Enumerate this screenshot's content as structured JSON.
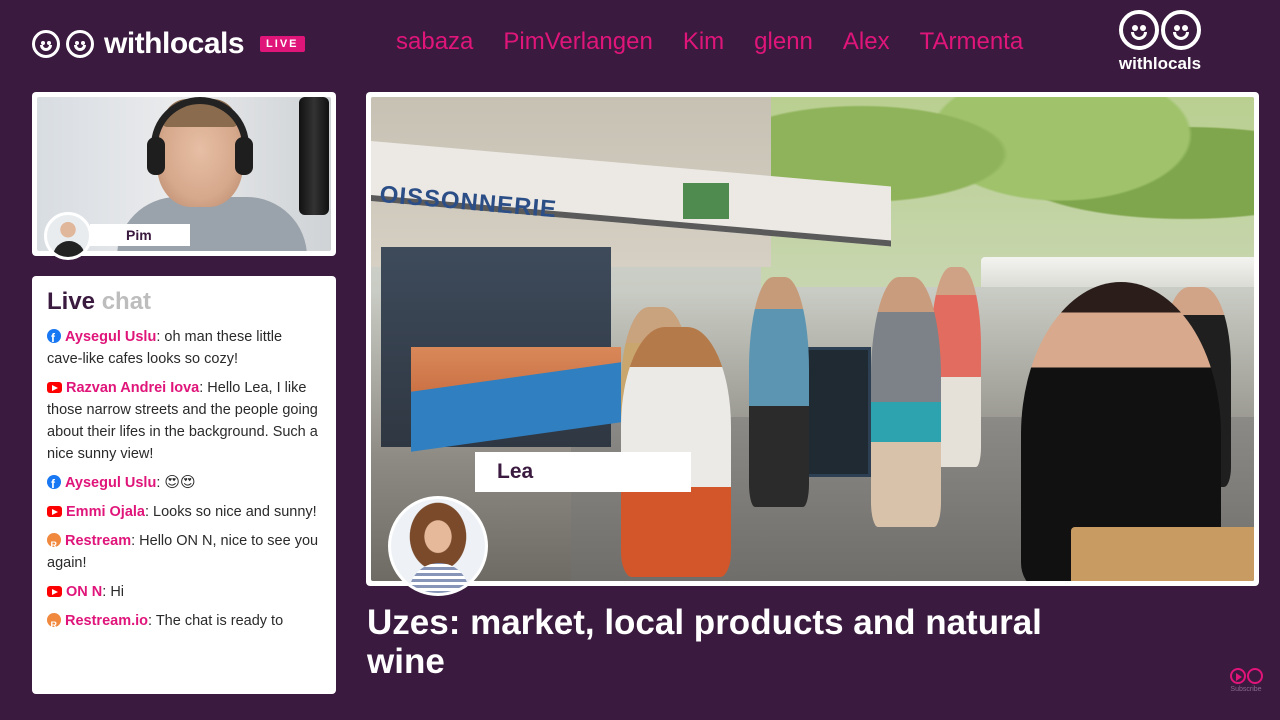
{
  "brand": {
    "name": "withlocals",
    "live_label": "LIVE",
    "corner_name": "withlocals"
  },
  "guests": [
    "sabaza",
    "PimVerlangen",
    "Kim",
    "glenn",
    "Alex",
    "TArmenta"
  ],
  "host": {
    "name": "Pim"
  },
  "presenter": {
    "name": "Lea"
  },
  "chat": {
    "title_main": "Live",
    "title_dim": "chat",
    "messages": [
      {
        "source": "facebook",
        "author": "Aysegul Uslu",
        "text": "oh man these little cave-like cafes looks so cozy!"
      },
      {
        "source": "youtube",
        "author": "Razvan Andrei Iova",
        "text": "Hello Lea, I like those narrow streets and the people going about their lifes in the background. Such a nice sunny view!"
      },
      {
        "source": "facebook",
        "author": "Aysegul Uslu",
        "text": "😍😍"
      },
      {
        "source": "youtube",
        "author": "Emmi Ojala",
        "text": "Looks so nice and sunny!"
      },
      {
        "source": "restream",
        "author": "Restream",
        "text": "Hello ON N, nice to see you again!"
      },
      {
        "source": "youtube",
        "author": "ON N",
        "text": "Hi"
      },
      {
        "source": "restream",
        "author": "Restream.io",
        "text": "The chat is ready to"
      }
    ]
  },
  "video": {
    "sign_text": "OISSONNERIE",
    "title": "Uzes: market, local products and natural wine"
  },
  "subscribe": {
    "label": "Subscribe"
  },
  "colors": {
    "background": "#3a1a3f",
    "accent": "#e0157a",
    "panel": "#ffffff"
  }
}
